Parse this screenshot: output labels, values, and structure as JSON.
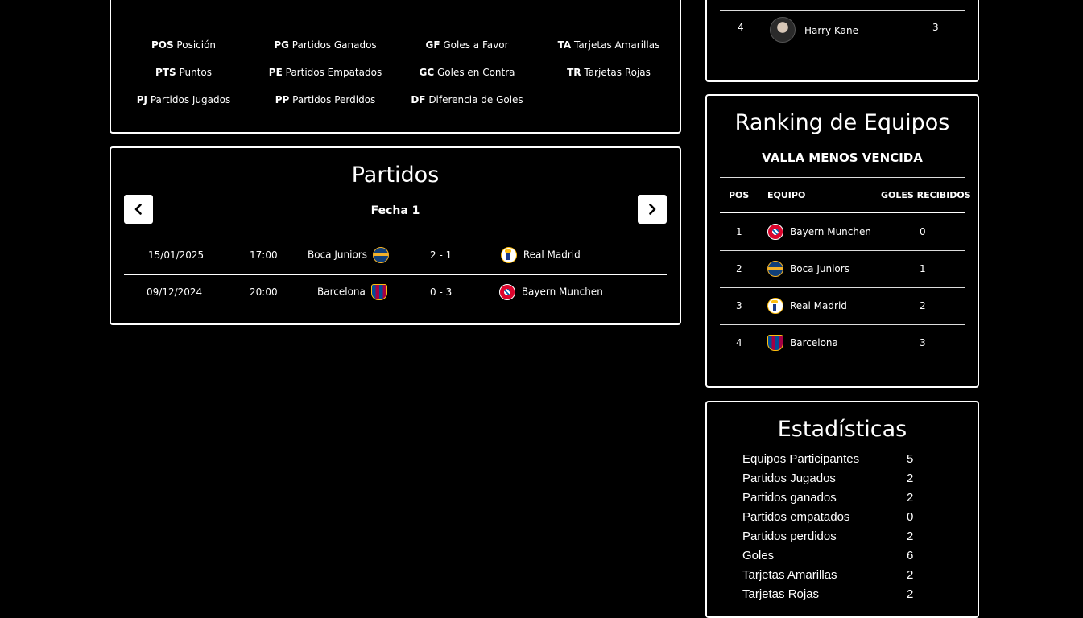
{
  "legend": {
    "items": [
      {
        "abbr": "POS",
        "desc": "Posición"
      },
      {
        "abbr": "PTS",
        "desc": "Puntos"
      },
      {
        "abbr": "PJ",
        "desc": "Partidos Jugados"
      },
      {
        "abbr": "PG",
        "desc": "Partidos Ganados"
      },
      {
        "abbr": "PE",
        "desc": "Partidos Empatados"
      },
      {
        "abbr": "PP",
        "desc": "Partidos Perdidos"
      },
      {
        "abbr": "GF",
        "desc": "Goles a Favor"
      },
      {
        "abbr": "GC",
        "desc": "Goles en Contra"
      },
      {
        "abbr": "DF",
        "desc": "Diferencia de Goles"
      },
      {
        "abbr": "TA",
        "desc": "Tarjetas Amarillas"
      },
      {
        "abbr": "TR",
        "desc": "Tarjetas Rojas"
      }
    ]
  },
  "matches": {
    "title": "Partidos",
    "round_label": "Fecha 1",
    "rows": [
      {
        "date": "15/01/2025",
        "time": "17:00",
        "home": "Boca Juniors",
        "home_crest": "boca-crest-icon",
        "score": "2 - 1",
        "away": "Real Madrid",
        "away_crest": "real-madrid-crest-icon"
      },
      {
        "date": "09/12/2024",
        "time": "20:00",
        "home": "Barcelona",
        "home_crest": "barcelona-crest-icon",
        "score": "0 - 3",
        "away": "Bayern Munchen",
        "away_crest": "bayern-crest-icon"
      }
    ]
  },
  "scorers": {
    "rows": [
      {
        "pos": "4",
        "player": "Harry Kane",
        "goals": "3"
      }
    ]
  },
  "ranking": {
    "title": "Ranking de Equipos",
    "subtitle": "VALLA MENOS VENCIDA",
    "headers": {
      "pos": "POS",
      "team": "EQUIPO",
      "value": "GOLES RECIBIDOS"
    },
    "rows": [
      {
        "pos": "1",
        "team": "Bayern Munchen",
        "crest": "bayern-crest-icon",
        "value": "0"
      },
      {
        "pos": "2",
        "team": "Boca Juniors",
        "crest": "boca-crest-icon",
        "value": "1"
      },
      {
        "pos": "3",
        "team": "Real Madrid",
        "crest": "real-madrid-crest-icon",
        "value": "2"
      },
      {
        "pos": "4",
        "team": "Barcelona",
        "crest": "barcelona-crest-icon",
        "value": "3"
      }
    ]
  },
  "stats": {
    "title": "Estadísticas",
    "rows": [
      {
        "label": "Equipos Participantes",
        "value": "5"
      },
      {
        "label": "Partidos Jugados",
        "value": "2"
      },
      {
        "label": "Partidos ganados",
        "value": "2"
      },
      {
        "label": "Partidos empatados",
        "value": "0"
      },
      {
        "label": "Partidos perdidos",
        "value": "2"
      },
      {
        "label": "Goles",
        "value": "6"
      },
      {
        "label": "Tarjetas Amarillas",
        "value": "2"
      },
      {
        "label": "Tarjetas Rojas",
        "value": "2"
      }
    ]
  },
  "colors": {
    "background": "#000000",
    "border": "#ffffff",
    "bayern_red": "#dc052d",
    "boca_blue": "#103f79",
    "boca_yellow": "#f3b229",
    "barca_blue": "#004d98",
    "barca_red": "#a50044",
    "real_gold": "#febe10"
  }
}
